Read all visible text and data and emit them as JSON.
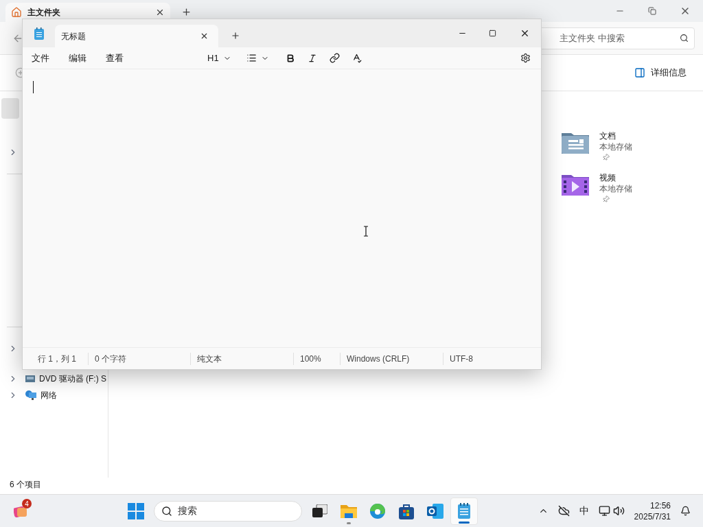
{
  "explorer": {
    "tab": {
      "title": "主文件夹",
      "selected": true
    },
    "search": {
      "placeholder": "主文件夹 中搜索"
    },
    "details_button": "详细信息",
    "sidebar": {
      "items": [
        {
          "kind": "selected-blank",
          "selected": true
        },
        {
          "kind": "chevron",
          "selected": false
        },
        {
          "kind": "chevron",
          "selected": false
        },
        {
          "kind": "drive",
          "label": "DVD 驱动器 (F:) S",
          "selected": false
        },
        {
          "kind": "network",
          "label": "网络",
          "selected": false
        }
      ]
    },
    "items": [
      {
        "kind": "documents",
        "name": "文档",
        "location": "本地存储",
        "pinned": true
      },
      {
        "kind": "videos",
        "name": "视频",
        "location": "本地存储",
        "pinned": true
      }
    ],
    "status": "6 个项目"
  },
  "notepad": {
    "tab": {
      "title": "无标题",
      "selected": true
    },
    "menu": [
      "文件",
      "编辑",
      "查看"
    ],
    "heading": "H1",
    "status": [
      "行 1，列 1",
      "0 个字符",
      "纯文本",
      "100%",
      "Windows (CRLF)",
      "UTF-8"
    ]
  },
  "taskbar": {
    "widget_badge": "4",
    "search": "搜索",
    "apps": [
      {
        "kind": "start",
        "running": false,
        "selected": false
      },
      {
        "kind": "taskview",
        "running": false,
        "selected": false
      },
      {
        "kind": "explorer",
        "running": true,
        "selected": false
      },
      {
        "kind": "edge",
        "running": false,
        "selected": false
      },
      {
        "kind": "store",
        "running": false,
        "selected": false
      },
      {
        "kind": "outlook",
        "running": false,
        "selected": false
      },
      {
        "kind": "notepad",
        "running": true,
        "selected": true
      }
    ],
    "ime": "中",
    "time": "12:56",
    "date": "2025/7/31"
  }
}
